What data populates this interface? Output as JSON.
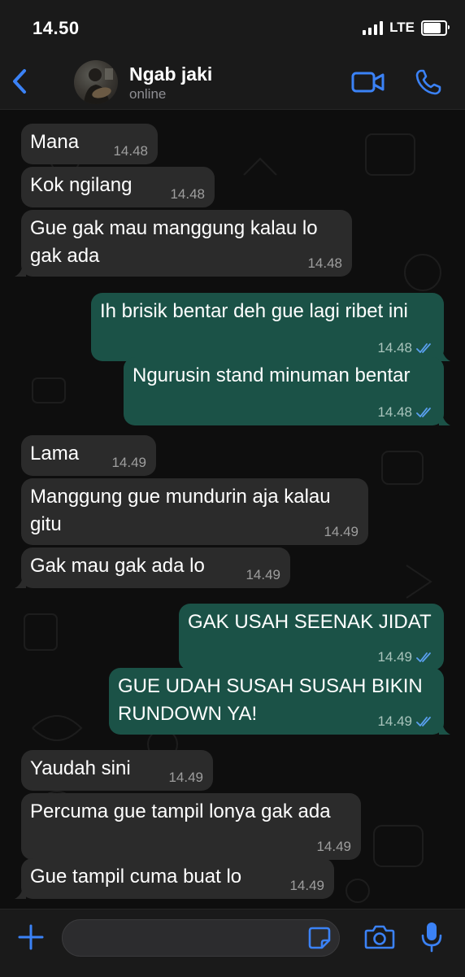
{
  "status_bar": {
    "time": "14.50",
    "network": "LTE",
    "battery_level": 0.8
  },
  "header": {
    "contact_name": "Ngab jaki",
    "contact_status": "online"
  },
  "icons": {
    "back": "chevron-left-icon",
    "video": "video-camera-icon",
    "call": "phone-icon",
    "add": "plus-icon",
    "sticker": "sticker-icon",
    "camera": "camera-icon",
    "mic": "microphone-icon",
    "read": "double-check-icon"
  },
  "colors": {
    "accent": "#3b82f6",
    "incoming_bubble": "#2b2b2b",
    "outgoing_bubble": "#1b5247",
    "read_receipt": "#5aa0f0"
  },
  "messages": [
    {
      "dir": "in",
      "text": "Mana",
      "time": "14.48"
    },
    {
      "dir": "in",
      "text": "Kok ngilang",
      "time": "14.48"
    },
    {
      "dir": "in",
      "text": "Gue gak mau manggung kalau lo gak ada",
      "time": "14.48"
    },
    {
      "dir": "out",
      "text": "Ih brisik bentar deh gue lagi ribet ini",
      "time": "14.48"
    },
    {
      "dir": "out",
      "text": "Ngurusin stand minuman bentar",
      "time": "14.48"
    },
    {
      "dir": "in",
      "text": "Lama",
      "time": "14.49"
    },
    {
      "dir": "in",
      "text": "Manggung gue mundurin aja kalau gitu",
      "time": "14.49"
    },
    {
      "dir": "in",
      "text": "Gak mau gak ada lo",
      "time": "14.49"
    },
    {
      "dir": "out",
      "text": "GAK USAH SEENAK JIDAT",
      "time": "14.49"
    },
    {
      "dir": "out",
      "text": "GUE UDAH SUSAH SUSAH BIKIN RUNDOWN YA!",
      "time": "14.49"
    },
    {
      "dir": "in",
      "text": "Yaudah sini",
      "time": "14.49"
    },
    {
      "dir": "in",
      "text": "Percuma gue tampil lonya gak ada",
      "time": "14.49"
    },
    {
      "dir": "in",
      "text": "Gue tampil cuma buat lo",
      "time": "14.49"
    }
  ],
  "composer": {
    "value": "",
    "placeholder": ""
  }
}
